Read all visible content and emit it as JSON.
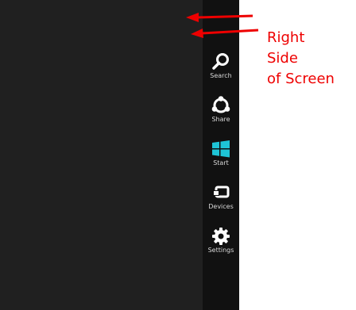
{
  "charms": [
    {
      "label": "Search",
      "icon": "magnifier-icon"
    },
    {
      "label": "Share",
      "icon": "share-icon"
    },
    {
      "label": "Start",
      "icon": "windows-logo-icon"
    },
    {
      "label": "Devices",
      "icon": "devices-icon"
    },
    {
      "label": "Settings",
      "icon": "gear-icon"
    }
  ],
  "annotation": {
    "lines": [
      "Right",
      "Side",
      "of Screen"
    ],
    "color": "#ee0000"
  },
  "colors": {
    "desktop_background": "#202020",
    "charms_background": "#111111",
    "charm_icon": "#ffffff",
    "start_icon": "#1ec4d6",
    "label_text": "#d8d8d8",
    "page_background": "#ffffff"
  }
}
